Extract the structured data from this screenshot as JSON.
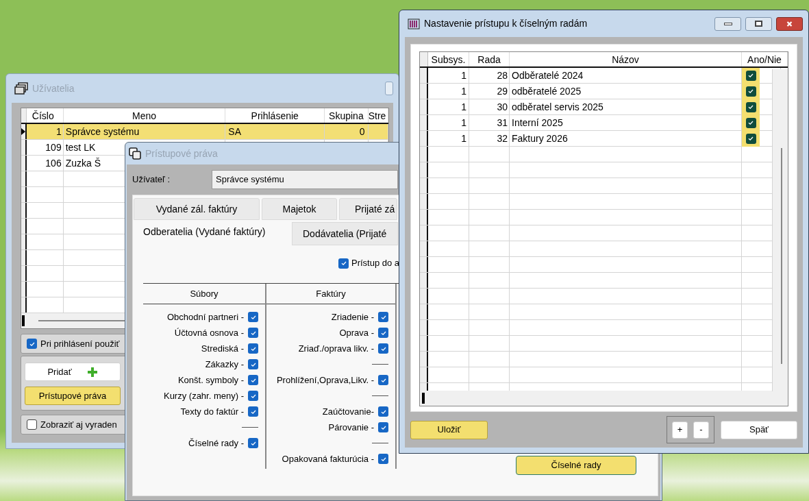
{
  "users_window": {
    "title": "Užívatelia",
    "columns": [
      "Číslo",
      "Meno",
      "Prihlásenie",
      "Skupina",
      "Stre"
    ],
    "rows": [
      {
        "number": "1",
        "name": "Správce systému",
        "login": "SA",
        "group": "0",
        "selected": true
      },
      {
        "number": "109",
        "name": "test LK",
        "selected": false
      },
      {
        "number": "106",
        "name": "Zuzka Š",
        "selected": false
      }
    ],
    "login_option": {
      "label": "Pri prihlásení použiť",
      "checked": true
    },
    "buttons": [
      {
        "label": "Pridať",
        "kind": "add",
        "highlighted": false
      },
      {
        "label": "Prístupové práva",
        "kind": "plain",
        "highlighted": true
      }
    ],
    "show_retired": {
      "label": "Zobraziť aj vyraden",
      "checked": false
    }
  },
  "rights_window": {
    "title": "Prístupové práva",
    "user_label": "Užívateľ :",
    "user_value": "Správce systému",
    "tabs_row_1": [
      {
        "label": "Vydané zál. faktúry",
        "selected": false
      },
      {
        "label": "Majetok",
        "selected": false
      },
      {
        "label": "Prijaté zá",
        "selected": false
      }
    ],
    "tabs_row_2": [
      {
        "label": "Odberatelia (Vydané faktúry)",
        "selected": true
      },
      {
        "label": "Dodávatelia (Prijaté",
        "selected": false
      }
    ],
    "access_option": {
      "label": "Prístup do a",
      "checked": true
    },
    "groups": [
      {
        "heading": "Súbory",
        "items": [
          {
            "kind": "check",
            "label": "Obchodní partneri -",
            "checked": true
          },
          {
            "kind": "check",
            "label": "Účtovná osnova -",
            "checked": true
          },
          {
            "kind": "check",
            "label": "Strediská -",
            "checked": true
          },
          {
            "kind": "check",
            "label": "Zákazky -",
            "checked": true
          },
          {
            "kind": "check",
            "label": "Konšt. symboly -",
            "checked": true
          },
          {
            "kind": "check",
            "label": "Kurzy (zahr. meny) -",
            "checked": true
          },
          {
            "kind": "check",
            "label": "Texty do faktúr -",
            "checked": true
          },
          {
            "kind": "separator"
          },
          {
            "kind": "check",
            "label": "Číselné rady -",
            "checked": true
          }
        ]
      },
      {
        "heading": "Faktúry",
        "items": [
          {
            "kind": "check",
            "label": "Zriadenie -",
            "checked": true
          },
          {
            "kind": "check",
            "label": "Oprava -",
            "checked": true
          },
          {
            "kind": "check",
            "label": "Zriaď./oprava likv. -",
            "checked": true
          },
          {
            "kind": "separator"
          },
          {
            "kind": "check",
            "label": "Prohlížení,Oprava,Likv. -",
            "checked": true
          },
          {
            "kind": "separator"
          },
          {
            "kind": "check",
            "label": "Zaúčtovanie-",
            "checked": true
          },
          {
            "kind": "check",
            "label": "Párovanie -",
            "checked": true
          },
          {
            "kind": "separator"
          },
          {
            "kind": "check",
            "label": "Opakovaná fakturúcia -",
            "checked": true
          }
        ]
      }
    ],
    "series_button": {
      "label": "Číselné rady",
      "highlighted": true
    }
  },
  "series_window": {
    "title": "Nastavenie prístupu k číselným radám",
    "columns": [
      "Subsys.",
      "Rada",
      "Názov",
      "Ano/Nie"
    ],
    "rows": [
      {
        "subsystem": "1",
        "series": "28",
        "name": "Odběratelé 2024",
        "allowed": true
      },
      {
        "subsystem": "1",
        "series": "29",
        "name": "odběratelé 2025",
        "allowed": true
      },
      {
        "subsystem": "1",
        "series": "30",
        "name": "odběratel servis 2025",
        "allowed": true
      },
      {
        "subsystem": "1",
        "series": "31",
        "name": "Interní 2025",
        "allowed": true
      },
      {
        "subsystem": "1",
        "series": "32",
        "name": "Faktury 2026",
        "allowed": true
      }
    ],
    "buttons": [
      {
        "label": "Uložiť",
        "kind": "save",
        "highlighted": true
      },
      {
        "label": "+",
        "kind": "step",
        "highlighted": false
      },
      {
        "label": "-",
        "kind": "step",
        "highlighted": false
      },
      {
        "label": "Späť",
        "kind": "back",
        "highlighted": false
      }
    ]
  }
}
